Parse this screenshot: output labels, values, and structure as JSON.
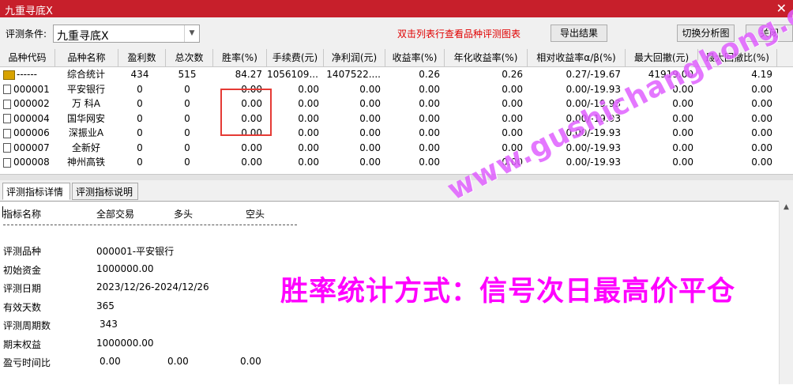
{
  "window": {
    "title": "九重寻底X"
  },
  "toolbar": {
    "condition_label": "评测条件:",
    "condition_value": "九重寻底X",
    "hint": "双击列表行查看品种评测图表",
    "export_label": "导出结果",
    "switch_label": "切换分析图",
    "close_label": "关闭"
  },
  "grid": {
    "columns": [
      "品种代码",
      "品种名称",
      "盈利数",
      "总次数",
      "胜率(%)",
      "手续费(元)",
      "净利润(元)",
      "收益率(%)",
      "年化收益率(%)",
      "相对收益率α/β(%)",
      "最大回撤(元)",
      "最大回撤比(%)"
    ],
    "rows": [
      {
        "code": "------",
        "name": "综合统计",
        "win": "434",
        "total": "515",
        "rate": "84.27",
        "fee": "1056109....",
        "profit": "1407522....",
        "ret": "0.26",
        "annual": "0.26",
        "rel": "0.27/-19.67",
        "dd": "41919.00",
        "ddr": "4.19",
        "icon": "folder"
      },
      {
        "code": "000001",
        "name": "平安银行",
        "win": "0",
        "total": "0",
        "rate": "0.00",
        "fee": "0.00",
        "profit": "0.00",
        "ret": "0.00",
        "annual": "0.00",
        "rel": "0.00/-19.93",
        "dd": "0.00",
        "ddr": "0.00",
        "icon": "doc"
      },
      {
        "code": "000002",
        "name": "万 科A",
        "win": "0",
        "total": "0",
        "rate": "0.00",
        "fee": "0.00",
        "profit": "0.00",
        "ret": "0.00",
        "annual": "0.00",
        "rel": "0.00/-19.93",
        "dd": "0.00",
        "ddr": "0.00",
        "icon": "doc"
      },
      {
        "code": "000004",
        "name": "国华网安",
        "win": "0",
        "total": "0",
        "rate": "0.00",
        "fee": "0.00",
        "profit": "0.00",
        "ret": "0.00",
        "annual": "0.00",
        "rel": "0.00/-19.93",
        "dd": "0.00",
        "ddr": "0.00",
        "icon": "doc"
      },
      {
        "code": "000006",
        "name": "深振业A",
        "win": "0",
        "total": "0",
        "rate": "0.00",
        "fee": "0.00",
        "profit": "0.00",
        "ret": "0.00",
        "annual": "0.00",
        "rel": "0.00/-19.93",
        "dd": "0.00",
        "ddr": "0.00",
        "icon": "doc"
      },
      {
        "code": "000007",
        "name": "全新好",
        "win": "0",
        "total": "0",
        "rate": "0.00",
        "fee": "0.00",
        "profit": "0.00",
        "ret": "0.00",
        "annual": "0.00",
        "rel": "0.00/-19.93",
        "dd": "0.00",
        "ddr": "0.00",
        "icon": "doc"
      },
      {
        "code": "000008",
        "name": "神州高铁",
        "win": "0",
        "total": "0",
        "rate": "0.00",
        "fee": "0.00",
        "profit": "0.00",
        "ret": "0.00",
        "annual": "0.00",
        "rel": "0.00/-19.93",
        "dd": "0.00",
        "ddr": "0.00",
        "icon": "doc"
      }
    ]
  },
  "tabs": [
    "评测指标详情",
    "评测指标说明"
  ],
  "detail": {
    "header": {
      "name": "指标名称",
      "all": "全部交易",
      "long": "多头",
      "short": "空头"
    },
    "divider": "--------------------------------------------------------------------------",
    "items": [
      {
        "label": "评测品种",
        "all": "000001-平安银行",
        "long": "",
        "short": ""
      },
      {
        "label": "初始资金",
        "all": "1000000.00",
        "long": "",
        "short": ""
      },
      {
        "label": "评测日期",
        "all": "2023/12/26-2024/12/26",
        "long": "",
        "short": ""
      },
      {
        "label": "有效天数",
        "all": "365",
        "long": "",
        "short": ""
      },
      {
        "label": "评测周期数",
        "all": "343",
        "long": "",
        "short": ""
      },
      {
        "label": "期末权益",
        "all": "1000000.00",
        "long": "",
        "short": ""
      },
      {
        "label": "盈亏时间比",
        "all": "0.00",
        "long": "0.00",
        "short": "0.00"
      }
    ]
  },
  "overlay": {
    "caption": "胜率统计方式：信号次日最高价平仓",
    "watermark": "www.gushichanghong.com"
  },
  "colors": {
    "titlebar": "#c71f2b",
    "hint": "#e00000",
    "caption": "#ff00ff",
    "highlight": "#e53a35"
  }
}
